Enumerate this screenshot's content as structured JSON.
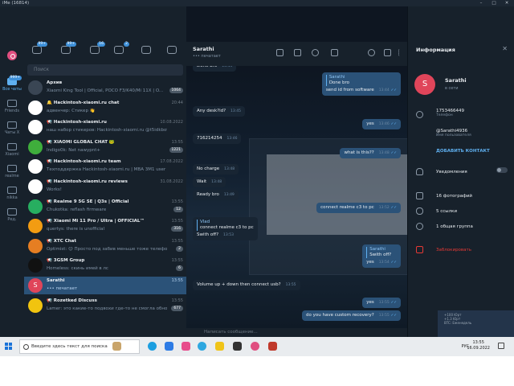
{
  "window": {
    "title": "iMe (16814)"
  },
  "folders": [
    {
      "label": "Все чаты",
      "badge": "999+",
      "active": true
    },
    {
      "label": "Friends",
      "badge": ""
    },
    {
      "label": "Чаты X",
      "badge": ""
    },
    {
      "label": "Xiaomi",
      "badge": ""
    },
    {
      "label": "realme",
      "badge": ""
    },
    {
      "label": "nikka",
      "badge": ""
    },
    {
      "label": "Ред.",
      "badge": ""
    }
  ],
  "top_icons": [
    {
      "name": "chats",
      "badge": "99+"
    },
    {
      "name": "contacts",
      "badge": "99+"
    },
    {
      "name": "groups",
      "badge": "16"
    },
    {
      "name": "channels",
      "badge": "2"
    },
    {
      "name": "bots",
      "badge": ""
    },
    {
      "name": "favorites",
      "badge": ""
    }
  ],
  "search": {
    "placeholder": "Поиск"
  },
  "chats": [
    {
      "name": "Архив",
      "preview": "Xiaomi King Tool | Official, POCO F3/K40/Mi 11X | O...",
      "time": "",
      "count": "1064",
      "avatar": "#3a4654"
    },
    {
      "name": "🔔 Hackintosh-xiaomi.ru chat",
      "preview": "адвенчер: Стикер 👋",
      "time": "20:44",
      "count": "",
      "avatar": "#ffffff"
    },
    {
      "name": "📢 Hackintosh-xiaomi.ru",
      "preview": "наш набор стикеров: Hackintosh-xiaomi.ru @t5idkbot...",
      "time": "10.08.2022",
      "count": "",
      "avatar": "#ffffff"
    },
    {
      "name": "📢 XIAOMI GLOBAL CHAT 🐸",
      "preview": "Indigo0k: Net nawypnt+",
      "time": "13:55",
      "count": "1221",
      "avatar": "#3fae3c"
    },
    {
      "name": "📢 Hackintosh-xiaomi.ru team",
      "preview": "Техподдержка Hackintosh-xiaomi.ru | MBA 3M1 user sa...",
      "time": "17.08.2022",
      "count": "",
      "avatar": "#ffffff"
    },
    {
      "name": "📢 Hackintosh-xiaomi.ru reviews",
      "preview": "Works!",
      "time": "31.08.2022",
      "count": "",
      "avatar": "#ffffff"
    },
    {
      "name": "📢 Realme 9 5G SE | Q3s | Official",
      "preview": "Chukotka: reflash firmware",
      "time": "13:55",
      "count": "12",
      "avatar": "#27ae60"
    },
    {
      "name": "📢 Xiaomi Mi 11 Pro / Ultra | OFFICIAL™",
      "preview": "quertys: there is unofficial",
      "time": "13:55",
      "count": "316",
      "avatar": "#f39c12"
    },
    {
      "name": "📢 XTC Chat",
      "preview": "Optimist: 😊 Просто под забив меньше тоже телефон...",
      "time": "13:55",
      "count": "2",
      "avatar": "#e67e22"
    },
    {
      "name": "📢 3GSM Group",
      "preview": "Homeless: скинь имей в лс",
      "time": "13:55",
      "count": "6",
      "avatar": "#111111"
    },
    {
      "name": "Sarathi",
      "preview": "••• печатает",
      "time": "13:55",
      "count": "",
      "avatar": "#e0455a",
      "selected": true,
      "letter": "S"
    },
    {
      "name": "📢 Rozetked Discuss",
      "preview": "Lamer: это какие-то подвохи где-то не смогла обновлю...",
      "time": "13:55",
      "count": "677",
      "avatar": "#f1c40f"
    }
  ],
  "chat": {
    "title": "Sarathi",
    "status": "••• печатает",
    "composer_placeholder": "Написать сообщение...",
    "messages": [
      {
        "dir": "in",
        "text": "Done bro",
        "time": "13:44"
      },
      {
        "dir": "out",
        "reply_name": "Sarathi",
        "reply_text": "Done bro",
        "text": "send id from software",
        "time": "13:44"
      },
      {
        "dir": "in",
        "text": "Any desk?id?",
        "time": "13:45"
      },
      {
        "dir": "out",
        "text": "yes",
        "time": "13:46"
      },
      {
        "dir": "in",
        "text": "716214254",
        "time": "13:46"
      },
      {
        "dir": "out",
        "text": "what is this??",
        "time": "13:48"
      },
      {
        "dir": "in",
        "text": "No charge",
        "time": "13:48"
      },
      {
        "dir": "in",
        "text": "Wait",
        "time": "13:48"
      },
      {
        "dir": "in",
        "text": "Ready bro",
        "time": "13:49"
      },
      {
        "dir": "out",
        "text": "connect realme c3 to pc",
        "time": "13:52"
      },
      {
        "dir": "in",
        "reply_name": "Vlad",
        "reply_text": "connect realme c3 to pc",
        "text": "Swith off?",
        "time": "13:53"
      },
      {
        "dir": "out",
        "reply_name": "Sarathi",
        "reply_text": "Swith off?",
        "text": "yes",
        "time": "13:54"
      },
      {
        "dir": "in",
        "text": "Volume up + down then connect usb?",
        "time": "13:55"
      },
      {
        "dir": "out",
        "text": "yes",
        "time": "13:55"
      },
      {
        "dir": "out",
        "text": "do you have custom recovery?",
        "time": "13:55"
      }
    ]
  },
  "info": {
    "header": "Информация",
    "name": "Sarathi",
    "status": "в сети",
    "avatar_letter": "S",
    "phone": "17534664​49",
    "phone_label": "Телефон",
    "username": "@Sarathi4936",
    "username_label": "Имя пользователя",
    "add_contact": "ДОБАВИТЬ КОНТАКТ",
    "notifications": "Уведомления",
    "photos": "16 фотографий",
    "links": "5 ссылки",
    "groups": "1 общая группа",
    "block": "Заблокировать",
    "corner_text": "+100 Юрт\n+1.3 Юрт\nBTC: Еженедель"
  },
  "taskbar": {
    "search_placeholder": "Введите здесь текст для поиска",
    "lang": "РУС",
    "time": "13:55",
    "date": "16.09.2022"
  }
}
